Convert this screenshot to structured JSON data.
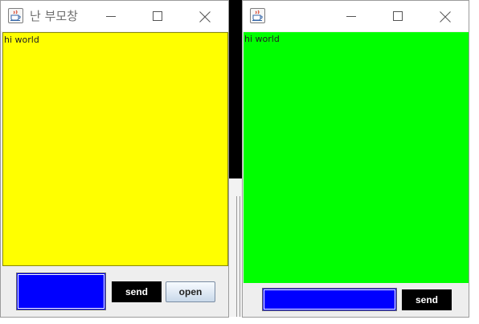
{
  "parent_window": {
    "title": "난 부모창",
    "content_text": "hi world",
    "content_color": "#ffff00",
    "input_color": "#0000ff",
    "send_label": "send",
    "open_label": "open",
    "icon": "java-cup-icon"
  },
  "child_window": {
    "title": "",
    "content_text": "hi world",
    "content_color": "#00ff00",
    "input_color": "#0000ff",
    "send_label": "send",
    "icon": "java-cup-icon"
  },
  "title_bar_icons": [
    "minimize-icon",
    "maximize-icon",
    "close-icon"
  ]
}
